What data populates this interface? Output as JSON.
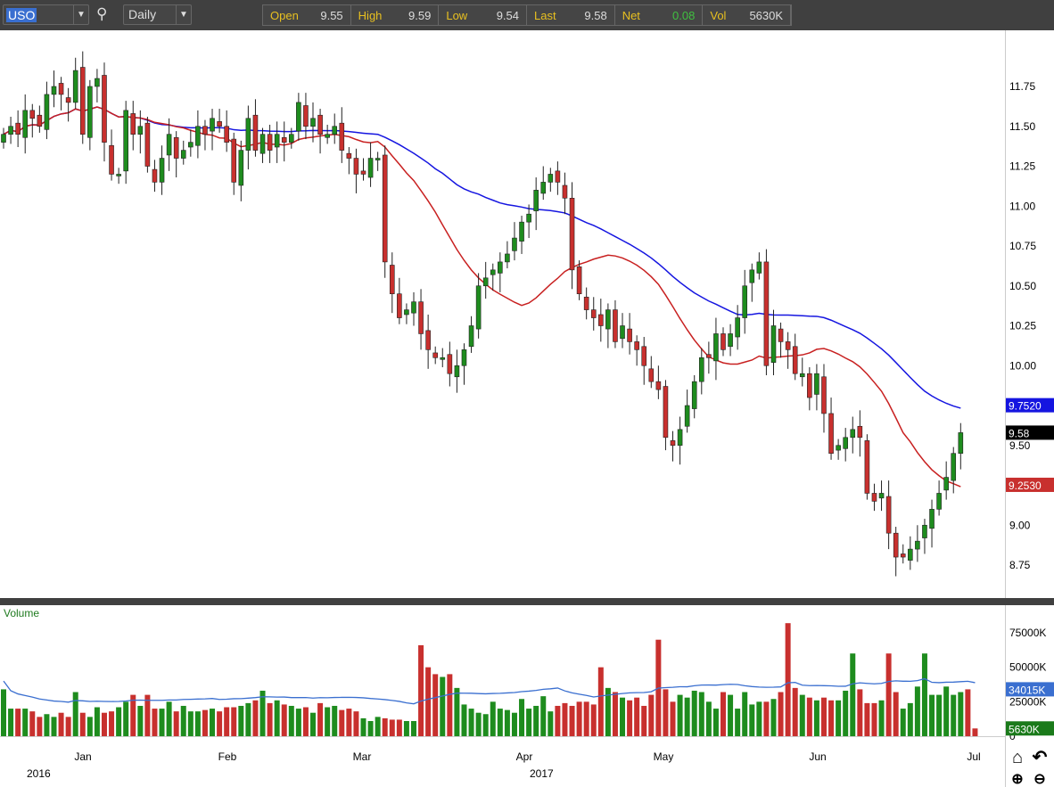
{
  "toolbar": {
    "symbol": "USO",
    "period": "Daily",
    "quote": [
      {
        "label": "Open",
        "value": "9.55"
      },
      {
        "label": "High",
        "value": "9.59"
      },
      {
        "label": "Low",
        "value": "9.54"
      },
      {
        "label": "Last",
        "value": "9.58"
      },
      {
        "label": "Net",
        "value": "0.08"
      },
      {
        "label": "Vol",
        "value": "5630K"
      }
    ]
  },
  "colors": {
    "up": "#1e8c1e",
    "down": "#c8302e",
    "ma_short": "#c82020",
    "ma_long": "#1515e0",
    "vol_avg": "#3a6fd0",
    "net": "#40c040"
  },
  "chart_data": {
    "type": "candlestick",
    "ylim": [
      8.6,
      12.05
    ],
    "yticks": [
      "11.75",
      "11.50",
      "11.25",
      "11.00",
      "10.75",
      "10.50",
      "10.25",
      "10.00",
      "9.75",
      "9.50",
      "9.25",
      "9.00",
      "8.75"
    ],
    "months": [
      "Jan",
      "Feb",
      "Mar",
      "Apr",
      "May",
      "Jun",
      "Jul"
    ],
    "years": [
      "2016",
      "2017"
    ],
    "closes": [
      11.45,
      11.5,
      11.45,
      11.6,
      11.55,
      11.5,
      11.7,
      11.75,
      11.7,
      11.65,
      11.85,
      11.45,
      11.75,
      11.8,
      11.4,
      11.2,
      11.2,
      11.6,
      11.45,
      11.5,
      11.25,
      11.15,
      11.3,
      11.45,
      11.3,
      11.35,
      11.4,
      11.5,
      11.45,
      11.55,
      11.5,
      11.4,
      11.15,
      11.35,
      11.55,
      11.35,
      11.45,
      11.35,
      11.45,
      11.4,
      11.45,
      11.65,
      11.5,
      11.55,
      11.45,
      11.45,
      11.5,
      11.35,
      11.3,
      11.2,
      11.2,
      11.3,
      11.3,
      10.65,
      10.45,
      10.3,
      10.35,
      10.4,
      10.2,
      10.1,
      10.05,
      10.05,
      9.95,
      10.0,
      10.1,
      10.25,
      10.5,
      10.55,
      10.6,
      10.65,
      10.7,
      10.8,
      10.9,
      10.95,
      11.1,
      11.15,
      11.2,
      11.15,
      11.05,
      10.6,
      10.45,
      10.35,
      10.3,
      10.25,
      10.35,
      10.15,
      10.25,
      10.15,
      10.1,
      10.0,
      9.9,
      9.85,
      9.55,
      9.5,
      9.6,
      9.75,
      9.9,
      10.05,
      10.05,
      10.2,
      10.1,
      10.2,
      10.3,
      10.5,
      10.6,
      10.65,
      10.0,
      10.25,
      10.15,
      10.1,
      9.95,
      9.95,
      9.8,
      9.95,
      9.7,
      9.45,
      9.5,
      9.55,
      9.6,
      9.55,
      9.2,
      9.15,
      9.2,
      8.95,
      8.8,
      8.8,
      8.85,
      8.9,
      9.0,
      9.1,
      9.2,
      9.3,
      9.45,
      9.58
    ],
    "volumes": [
      34000,
      20000,
      20000,
      20000,
      18000,
      14000,
      16000,
      14000,
      17000,
      14000,
      32000,
      17000,
      14000,
      21000,
      17000,
      18000,
      21000,
      25000,
      30000,
      22000,
      30000,
      20000,
      20000,
      25000,
      18000,
      22000,
      18000,
      18000,
      19000,
      20000,
      18000,
      21000,
      21000,
      22000,
      24000,
      26000,
      33000,
      24000,
      26000,
      23000,
      22000,
      20000,
      21000,
      17000,
      24000,
      21000,
      22000,
      19000,
      20000,
      18000,
      13000,
      11000,
      14000,
      13000,
      12000,
      12000,
      11000,
      11000,
      66000,
      50000,
      45000,
      43000,
      45000,
      35000,
      23000,
      20000,
      17000,
      16000,
      25000,
      20000,
      19000,
      17000,
      27000,
      20000,
      22000,
      29000,
      18000,
      22000,
      24000,
      22000,
      25000,
      25000,
      23000,
      50000,
      35000,
      32000,
      28000,
      26000,
      28000,
      22000,
      30000,
      70000,
      34000,
      25000,
      30000,
      28000,
      33000,
      32000,
      25000,
      20000,
      32000,
      30000,
      20000,
      32000,
      23000,
      25000,
      25000,
      27000,
      32000,
      82000,
      35000,
      30000,
      28000,
      26000,
      28000,
      26000,
      26000,
      33000,
      60000,
      34000,
      24000,
      24000,
      26000,
      60000,
      32000,
      20000,
      24000,
      36000,
      60000,
      30000,
      30000,
      36000,
      30000,
      32000,
      34000,
      5630
    ],
    "tags": {
      "ma_long": "9.7520",
      "last": "9.58",
      "ma_short": "9.2530"
    },
    "volume": {
      "title": "Volume",
      "yticks": [
        "75000K",
        "50000K",
        "25000K",
        "0"
      ],
      "avg_tag": "34015K",
      "last_tag": "5630K",
      "ylim": [
        0,
        90000
      ]
    }
  }
}
